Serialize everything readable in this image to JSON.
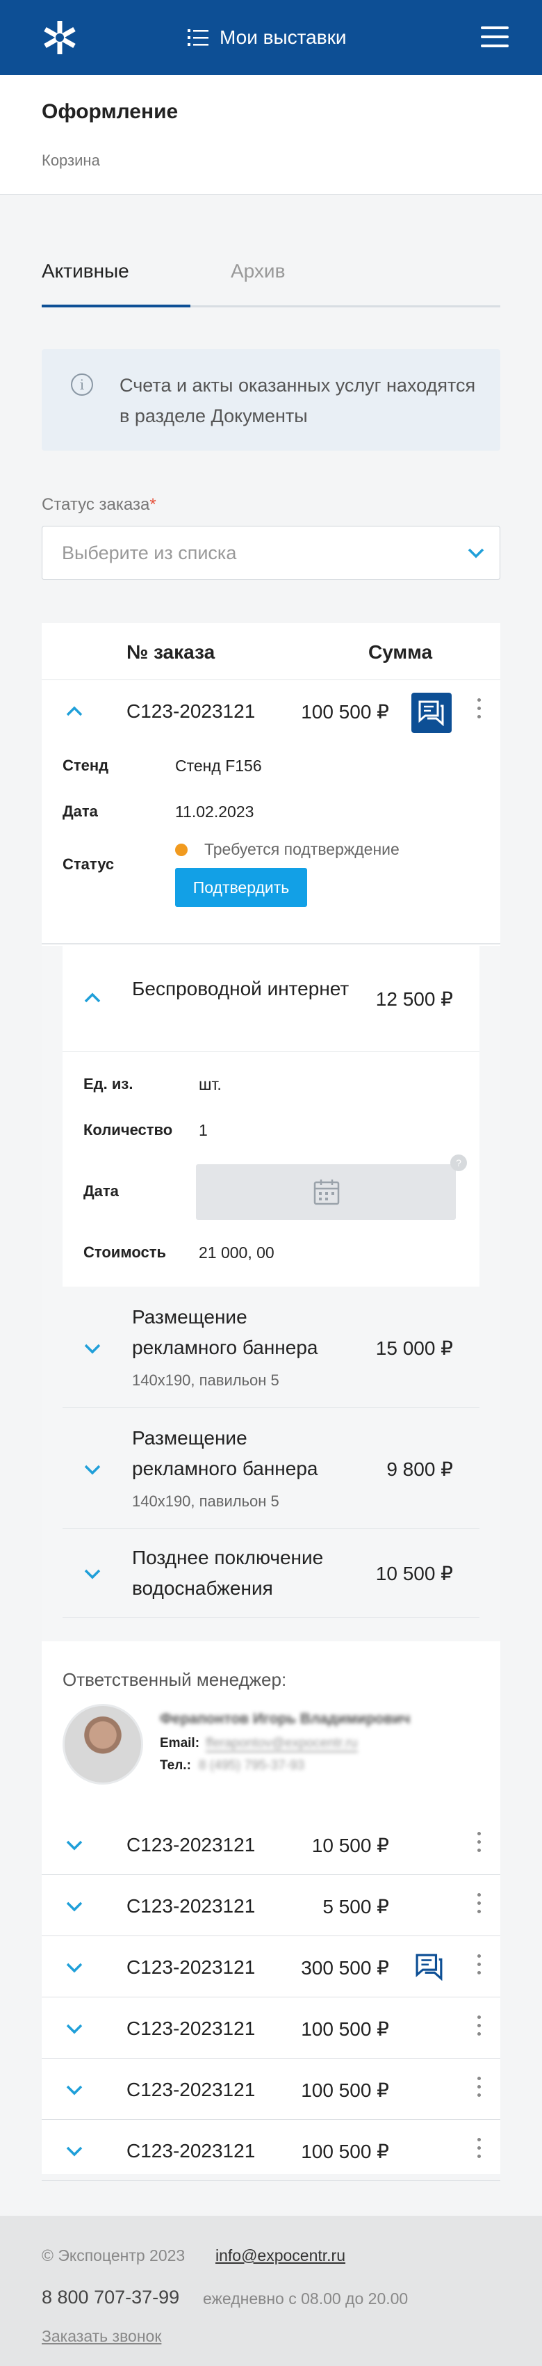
{
  "header": {
    "title": "Мои выставки"
  },
  "page": {
    "title": "Оформление",
    "breadcrumb": "Корзина"
  },
  "tabs": [
    {
      "label": "Активные",
      "active": true
    },
    {
      "label": "Архив",
      "active": false
    }
  ],
  "notice": {
    "text": "Счета и акты оказанных услуг находятся в разделе Документы"
  },
  "filter": {
    "label": "Статус заказа",
    "required_mark": "*",
    "placeholder": "Выберите из списка"
  },
  "orders_table": {
    "headers": {
      "number": "№ заказа",
      "sum": "Сумма"
    },
    "expanded_order": {
      "number": "C123-2023121",
      "sum": "100 500 ₽",
      "details": {
        "stand_label": "Стенд",
        "stand_value": "Стенд F156",
        "date_label": "Дата",
        "date_value": "11.02.2023",
        "status_label": "Статус",
        "status_value": "Требуется подтверждение",
        "confirm_button": "Подтвердить"
      },
      "services": {
        "open": {
          "name": "Беспроводной интернет",
          "price": "12 500 ₽",
          "unit_label": "Ед. из.",
          "unit_value": "шт.",
          "qty_label": "Количество",
          "qty_value": "1",
          "date_label": "Дата",
          "cost_label": "Стоимость",
          "cost_value": "21 000, 00"
        },
        "collapsed": [
          {
            "name": "Размещение рекламного баннера",
            "sub": "140x190, павильон 5",
            "price": "15 000 ₽"
          },
          {
            "name": "Размещение рекламного баннера",
            "sub": "140x190, павильон 5",
            "price": "9 800 ₽"
          },
          {
            "name": "Позднее поключение водоснабжения",
            "sub": "",
            "price": "10 500 ₽"
          }
        ]
      },
      "manager": {
        "label": "Ответственный менеджер:",
        "name": "Ферапонтов Игорь Владимирович",
        "email_label": "Email:",
        "email": "fferapontov@expocentr.ru",
        "phone_label": "Тел.:",
        "phone": "8 (495) 795-37-93"
      }
    },
    "other_orders": [
      {
        "number": "C123-2023121",
        "sum": "10 500 ₽",
        "chat": false
      },
      {
        "number": "C123-2023121",
        "sum": "5 500 ₽",
        "chat": false
      },
      {
        "number": "C123-2023121",
        "sum": "300 500 ₽",
        "chat": true
      },
      {
        "number": "C123-2023121",
        "sum": "100 500 ₽",
        "chat": false
      },
      {
        "number": "C123-2023121",
        "sum": "100 500 ₽",
        "chat": false
      },
      {
        "number": "C123-2023121",
        "sum": "100 500 ₽",
        "chat": false
      }
    ]
  },
  "footer": {
    "copyright": "© Экспоцентр 2023",
    "email": "info@expocentr.ru",
    "phone": "8 800 707-37-99",
    "hours": "ежедневно с 08.00 до 20.00",
    "callback": "Заказать звонок"
  },
  "colors": {
    "brand": "#0d4f95",
    "accent": "#12a0e6",
    "status_warning": "#f19a1f"
  },
  "icons": [
    "logo-icon",
    "list-icon",
    "burger-menu-icon",
    "info-icon",
    "chevron-down-icon",
    "chevron-up-icon",
    "chat-icon",
    "kebab-menu-icon",
    "calendar-icon"
  ]
}
